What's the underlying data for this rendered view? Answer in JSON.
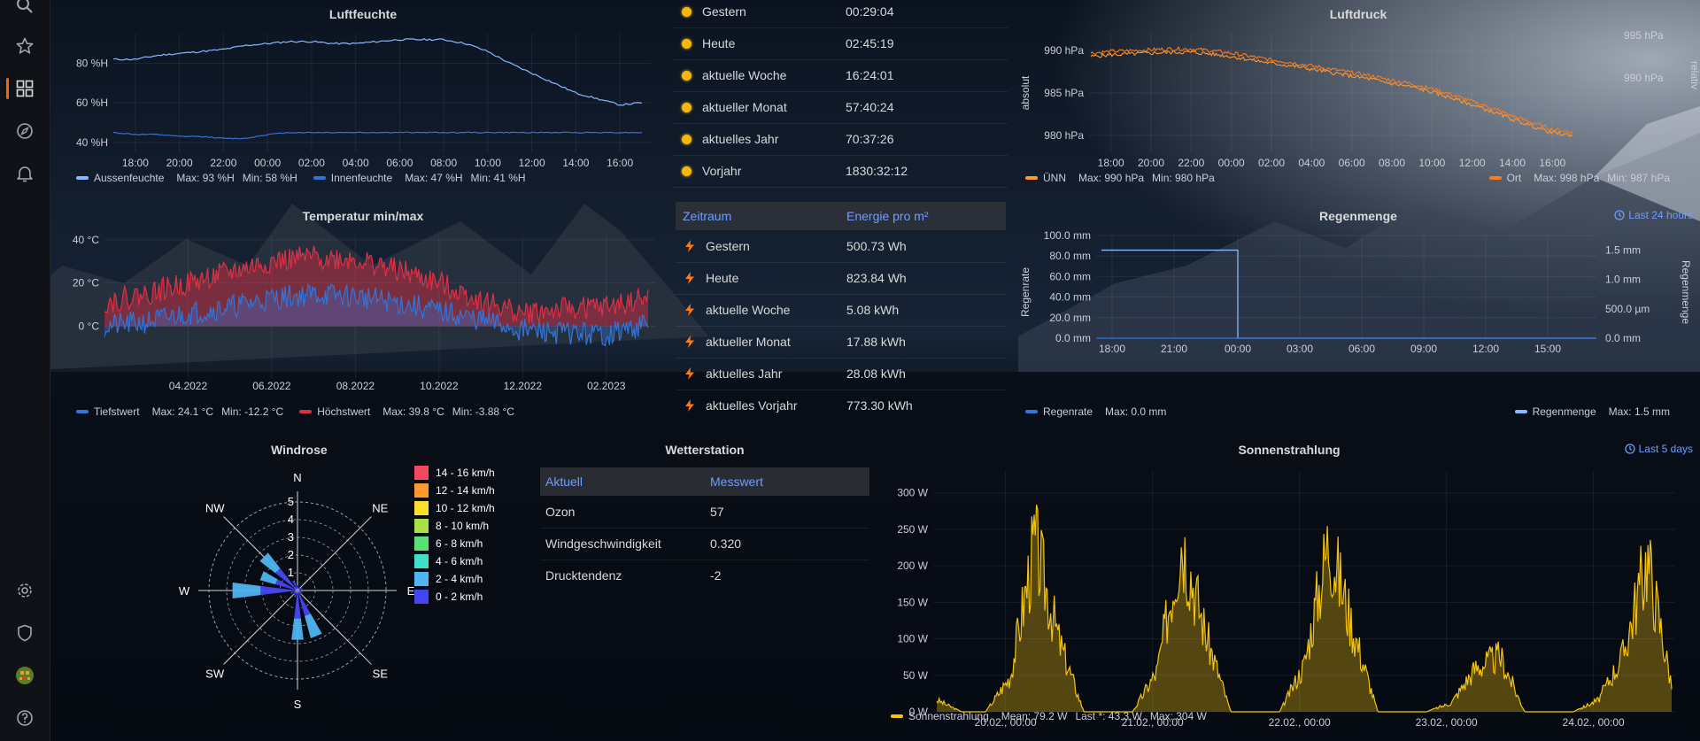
{
  "sidebar": {
    "icons": [
      "search-icon",
      "star-icon",
      "dashboards-icon",
      "explore-icon",
      "alerting-bell-icon",
      "settings-gear-icon",
      "shield-icon",
      "user-avatar",
      "help-icon"
    ]
  },
  "colors": {
    "accent_orange": "#f46800",
    "link_blue": "#6e9fff",
    "humidity_out": "#8ab8ff",
    "humidity_in": "#3274d9",
    "temp_low": "#3274d9",
    "temp_high": "#e02f44",
    "pressure_abs": "#ff9830",
    "pressure_rel": "#ff7a1a",
    "rain_rate": "#3274d9",
    "rain_total": "#8ab8ff",
    "sun": "#f5c30e"
  },
  "luftfeuchte": {
    "title": "Luftfeuchte",
    "legend": [
      {
        "name": "Aussenfeuchte",
        "stats": [
          "Max: 93 %H",
          "Min: 58 %H"
        ]
      },
      {
        "name": "Innenfeuchte",
        "stats": [
          "Max: 47 %H",
          "Min: 41 %H"
        ]
      }
    ],
    "chart_data": {
      "type": "line",
      "x": [
        "17:00",
        "18:00",
        "19:00",
        "20:00",
        "21:00",
        "22:00",
        "23:00",
        "00:00",
        "01:00",
        "02:00",
        "03:00",
        "04:00",
        "05:00",
        "06:00",
        "07:00",
        "08:00",
        "09:00",
        "10:00",
        "11:00",
        "12:00",
        "13:00",
        "14:00",
        "15:00",
        "16:00",
        "16:30"
      ],
      "xticks": [
        "18:00",
        "20:00",
        "22:00",
        "00:00",
        "02:00",
        "04:00",
        "06:00",
        "08:00",
        "10:00",
        "12:00",
        "14:00",
        "16:00"
      ],
      "yticks": [
        "40 %H",
        "60 %H",
        "80 %H"
      ],
      "ylim": [
        35,
        95
      ],
      "series": [
        {
          "name": "Aussenfeuchte",
          "values": [
            82,
            82,
            84,
            85,
            86,
            87,
            89,
            90,
            91,
            91,
            90,
            90,
            91,
            92,
            92,
            92,
            90,
            86,
            80,
            75,
            70,
            65,
            62,
            59,
            60
          ]
        },
        {
          "name": "Innenfeuchte",
          "values": [
            45,
            44,
            44,
            43,
            43,
            42,
            42,
            44,
            45,
            45,
            45,
            45,
            45,
            45,
            45,
            45,
            45,
            45,
            45,
            45,
            45,
            45,
            45,
            45,
            45
          ]
        }
      ]
    }
  },
  "luftdruck": {
    "title": "Luftdruck",
    "left_axis_label": "absolut",
    "right_axis_label": "relativ",
    "legend": [
      {
        "name": "ÜNN",
        "stats": [
          "Max: 990 hPa",
          "Min: 980 hPa"
        ]
      },
      {
        "name": "Ort",
        "stats": [
          "Max: 998 hPa",
          "Min: 987 hPa"
        ]
      }
    ],
    "chart_data": {
      "type": "line",
      "x": [
        "17:00",
        "18:00",
        "19:00",
        "20:00",
        "21:00",
        "22:00",
        "23:00",
        "00:00",
        "01:00",
        "02:00",
        "03:00",
        "04:00",
        "05:00",
        "06:00",
        "07:00",
        "08:00",
        "09:00",
        "10:00",
        "11:00",
        "12:00",
        "13:00",
        "14:00",
        "15:00",
        "16:00",
        "16:30"
      ],
      "xticks": [
        "18:00",
        "20:00",
        "22:00",
        "00:00",
        "02:00",
        "04:00",
        "06:00",
        "08:00",
        "10:00",
        "12:00",
        "14:00",
        "16:00"
      ],
      "yticks_left": [
        "980 hPa",
        "985 hPa",
        "990 hPa"
      ],
      "yticks_right": [
        "990 hPa",
        "995 hPa"
      ],
      "ylim": [
        978,
        992
      ],
      "series": [
        {
          "name": "ÜNN",
          "values": [
            989.3,
            989.5,
            989.6,
            989.7,
            989.8,
            989.8,
            989.6,
            989.3,
            988.9,
            988.5,
            988.2,
            987.8,
            987.4,
            987.0,
            986.6,
            986.1,
            985.7,
            985.1,
            984.4,
            983.6,
            982.8,
            981.9,
            981.1,
            980.3,
            980.0
          ]
        },
        {
          "name": "Ort",
          "values": [
            989.7,
            989.9,
            990.0,
            990.1,
            990.2,
            990.2,
            990.0,
            989.7,
            989.3,
            988.9,
            988.6,
            988.2,
            987.8,
            987.4,
            987.0,
            986.5,
            986.1,
            985.5,
            984.8,
            984.0,
            983.2,
            982.3,
            981.5,
            980.7,
            980.4
          ]
        }
      ]
    }
  },
  "sonnenstunden": {
    "rows": [
      {
        "label": "Gestern",
        "value": "00:29:04"
      },
      {
        "label": "Heute",
        "value": "02:45:19"
      },
      {
        "label": "aktuelle Woche",
        "value": "16:24:01"
      },
      {
        "label": "aktueller Monat",
        "value": "57:40:24"
      },
      {
        "label": "aktuelles Jahr",
        "value": "70:37:26"
      },
      {
        "label": "Vorjahr",
        "value": "1830:32:12"
      }
    ]
  },
  "energie": {
    "col1": "Zeitraum",
    "col2": "Energie pro m²",
    "rows": [
      {
        "label": "Gestern",
        "value": "500.73 Wh"
      },
      {
        "label": "Heute",
        "value": "823.84 Wh"
      },
      {
        "label": "aktuelle Woche",
        "value": "5.08 kWh"
      },
      {
        "label": "aktueller Monat",
        "value": "17.88 kWh"
      },
      {
        "label": "aktuelles Jahr",
        "value": "28.08 kWh"
      },
      {
        "label": "aktuelles Vorjahr",
        "value": "773.30 kWh"
      }
    ]
  },
  "temperatur": {
    "title": "Temperatur min/max",
    "legend": [
      {
        "name": "Tiefstwert",
        "stats": [
          "Max: 24.1 °C",
          "Min: -12.2 °C"
        ]
      },
      {
        "name": "Höchstwert",
        "stats": [
          "Max: 39.8 °C",
          "Min: -3.88 °C"
        ]
      }
    ],
    "chart_data": {
      "type": "area",
      "x": [
        "2022-02",
        "2022-03",
        "2022-04",
        "2022-05",
        "2022-06",
        "2022-07",
        "2022-08",
        "2022-09",
        "2022-10",
        "2022-11",
        "2022-12",
        "2023-01",
        "2023-02",
        "2023-03"
      ],
      "xticks": [
        "04.2022",
        "06.2022",
        "08.2022",
        "10.2022",
        "12.2022",
        "02.2023"
      ],
      "yticks": [
        "0 °C",
        "20 °C",
        "40 °C"
      ],
      "ylim": [
        -8,
        42
      ],
      "series": [
        {
          "name": "Tiefstwert",
          "values": [
            0,
            2,
            6,
            9,
            13,
            15,
            14,
            11,
            7,
            3,
            -2,
            -3,
            -4,
            1
          ]
        },
        {
          "name": "Höchstwert",
          "values": [
            11,
            15,
            20,
            25,
            30,
            32,
            31,
            26,
            20,
            12,
            6,
            8,
            9,
            13
          ]
        }
      ]
    }
  },
  "regenmenge": {
    "title": "Regenmenge",
    "time_range": "Last 24 hours",
    "left_axis_label": "Regenrate",
    "right_axis_label": "Regenmenge",
    "legend": [
      {
        "name": "Regenrate",
        "stats": [
          "Max: 0.0 mm"
        ]
      },
      {
        "name": "Regenmenge",
        "stats": [
          "Max: 1.5 mm"
        ]
      }
    ],
    "chart_data": {
      "type": "line",
      "x": [
        "17:00",
        "18:00",
        "21:00",
        "23:59",
        "00:00",
        "03:00",
        "06:00",
        "09:00",
        "12:00",
        "15:00",
        "17:00"
      ],
      "xticks": [
        "18:00",
        "21:00",
        "00:00",
        "03:00",
        "06:00",
        "09:00",
        "12:00",
        "15:00"
      ],
      "yticks_left": [
        "0.0 mm",
        "20.0 mm",
        "40.0 mm",
        "60.0 mm",
        "80.0 mm",
        "100.0 mm"
      ],
      "yticks_right": [
        "0.0 mm",
        "500.0 µm",
        "1.0 mm",
        "1.5 mm"
      ],
      "ylim_left": [
        0,
        100
      ],
      "ylim_right": [
        0,
        1.75
      ],
      "series": [
        {
          "name": "Regenrate",
          "values": [
            0,
            0,
            0,
            0,
            0,
            0,
            0,
            0,
            0,
            0,
            0
          ]
        },
        {
          "name": "Regenmenge",
          "values": [
            1.5,
            1.5,
            1.5,
            1.5,
            0,
            0,
            0,
            0,
            0,
            0,
            0
          ]
        }
      ]
    }
  },
  "windrose": {
    "title": "Windrose",
    "directions": [
      "N",
      "NE",
      "E",
      "SE",
      "S",
      "SW",
      "W",
      "NW"
    ],
    "rings": [
      "1",
      "2",
      "3",
      "4",
      "5"
    ],
    "speed_classes": [
      {
        "label": "14 - 16 km/h",
        "color": "#f2495c"
      },
      {
        "label": "12 - 14 km/h",
        "color": "#ff9830"
      },
      {
        "label": "10 - 12 km/h",
        "color": "#fade2a"
      },
      {
        "label": "8 - 10 km/h",
        "color": "#a8e045"
      },
      {
        "label": "6 - 8 km/h",
        "color": "#56e075"
      },
      {
        "label": "4 - 6 km/h",
        "color": "#3fe0c8"
      },
      {
        "label": "2 - 4 km/h",
        "color": "#4fb5f0"
      },
      {
        "label": "0 - 2 km/h",
        "color": "#4545f0"
      }
    ],
    "chart_data": {
      "type": "bar",
      "categories": [
        "N",
        "NNE",
        "NE",
        "ENE",
        "E",
        "ESE",
        "SE",
        "SSE",
        "S",
        "SSW",
        "SW",
        "WSW",
        "W",
        "WNW",
        "NW",
        "NNW"
      ],
      "series": [
        {
          "name": "0 - 2 km/h",
          "values": [
            0.3,
            0.2,
            0.2,
            0.3,
            0.2,
            0.3,
            0.3,
            1.5,
            1.6,
            0.4,
            0.3,
            0.4,
            2.1,
            1.3,
            1.6,
            0.6
          ]
        },
        {
          "name": "2 - 4 km/h",
          "values": [
            0,
            0,
            0,
            0,
            0,
            0,
            0,
            1.3,
            1.2,
            0,
            0,
            0,
            1.6,
            0.9,
            1.1,
            0
          ]
        }
      ],
      "rlim": [
        0,
        5
      ]
    }
  },
  "wetterstation": {
    "title": "Wetterstation",
    "col1": "Aktuell",
    "col2": "Messwert",
    "rows": [
      {
        "label": "Ozon",
        "value": "57"
      },
      {
        "label": "Windgeschwindigkeit",
        "value": "0.320"
      },
      {
        "label": "Drucktendenz",
        "value": "-2"
      }
    ]
  },
  "sonnenstrahlung": {
    "title": "Sonnenstrahlung",
    "time_range": "Last 5 days",
    "legend": [
      {
        "name": "Sonnenstrahlung",
        "stats": [
          "Mean: 79.2 W",
          "Last *: 43.3 W",
          "Max: 304 W"
        ]
      }
    ],
    "chart_data": {
      "type": "area",
      "x": [
        "19.02. 21:00",
        "20.02. 00:00",
        "20.02. 06:00",
        "20.02. 09:00",
        "20.02. 12:00",
        "20.02. 15:00",
        "20.02. 18:00",
        "21.02. 00:00",
        "21.02. 06:00",
        "21.02. 09:00",
        "21.02. 12:00",
        "21.02. 15:00",
        "21.02. 18:00",
        "22.02. 00:00",
        "22.02. 06:00",
        "22.02. 09:00",
        "22.02. 12:00",
        "22.02. 15:00",
        "22.02. 18:00",
        "23.02. 00:00",
        "23.02. 06:00",
        "23.02. 09:00",
        "23.02. 12:00",
        "23.02. 15:00",
        "23.02. 18:00",
        "24.02. 00:00",
        "24.02. 06:00",
        "24.02. 09:00",
        "24.02. 12:00",
        "24.02. 15:00",
        "24.02. 17:00"
      ],
      "xticks": [
        "20.02., 00:00",
        "21.02., 00:00",
        "22.02., 00:00",
        "23.02., 00:00",
        "24.02., 00:00"
      ],
      "yticks": [
        "0 W",
        "50 W",
        "100 W",
        "150 W",
        "200 W",
        "250 W",
        "300 W"
      ],
      "ylim": [
        0,
        330
      ],
      "series": [
        {
          "name": "Sonnenstrahlung",
          "values": [
            20,
            0,
            0,
            60,
            290,
            120,
            0,
            0,
            0,
            70,
            300,
            130,
            0,
            0,
            0,
            80,
            295,
            140,
            0,
            0,
            0,
            15,
            75,
            95,
            0,
            0,
            0,
            20,
            95,
            265,
            45
          ]
        }
      ]
    }
  }
}
